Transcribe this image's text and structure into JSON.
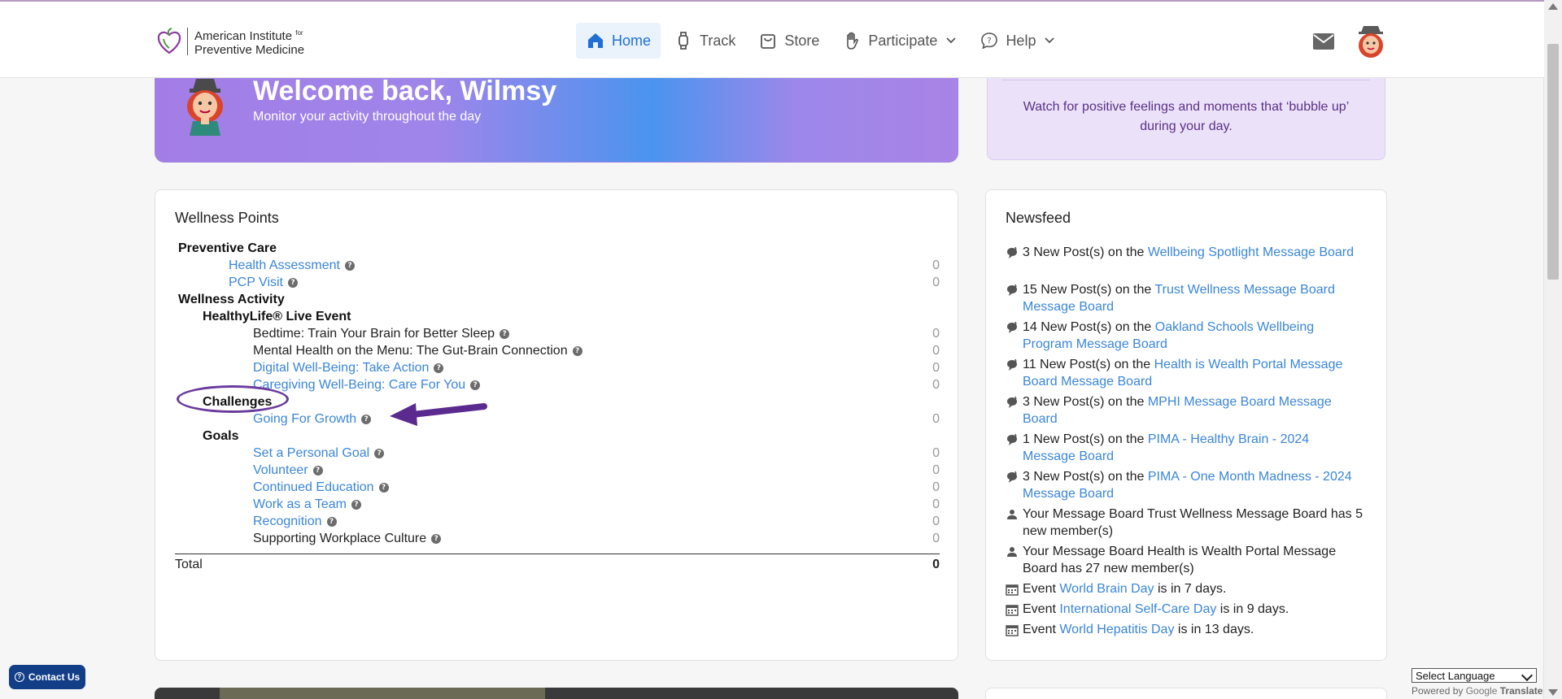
{
  "brand": {
    "line1": "American Institute",
    "line1_suffix": "for",
    "line2": "Preventive Medicine",
    "colors": {
      "accent": "#1f6fd6",
      "link": "#3a86d8",
      "purple": "#6a3b9c"
    }
  },
  "nav": {
    "home": "Home",
    "track": "Track",
    "store": "Store",
    "participate": "Participate",
    "help": "Help"
  },
  "banner": {
    "title": "Welcome back, Wilmsy",
    "subtitle": "Monitor your activity throughout the day"
  },
  "tip": {
    "text": "Watch for positive feelings and moments that ‘bubble up’ during your day."
  },
  "wellness": {
    "title": "Wellness Points",
    "rows": [
      {
        "label": "Preventive Care",
        "value": ""
      },
      {
        "label": "Health Assessment",
        "value": "0"
      },
      {
        "label": "PCP Visit",
        "value": "0"
      },
      {
        "label": "Wellness Activity",
        "value": ""
      },
      {
        "label": "HealthyLife® Live Event",
        "value": ""
      },
      {
        "label": "Bedtime: Train Your Brain for Better Sleep",
        "value": "0"
      },
      {
        "label": "Mental Health on the Menu: The Gut-Brain Connection",
        "value": "0"
      },
      {
        "label": "Digital Well-Being: Take Action",
        "value": "0"
      },
      {
        "label": "Caregiving Well-Being: Care For You",
        "value": "0"
      },
      {
        "label": "Challenges",
        "value": ""
      },
      {
        "label": "Going For Growth",
        "value": "0"
      },
      {
        "label": "Goals",
        "value": ""
      },
      {
        "label": "Set a Personal Goal",
        "value": "0"
      },
      {
        "label": "Volunteer",
        "value": "0"
      },
      {
        "label": "Continued Education",
        "value": "0"
      },
      {
        "label": "Work as a Team",
        "value": "0"
      },
      {
        "label": "Recognition",
        "value": "0"
      },
      {
        "label": "Supporting Workplace Culture",
        "value": "0"
      }
    ],
    "help_glyph": "?",
    "total_label": "Total",
    "total_value": "0"
  },
  "newsfeed": {
    "title": "Newsfeed",
    "items": [
      {
        "icon": "speech-bubble-icon",
        "pre": "3 New Post(s) on the ",
        "link": "Wellbeing Spotlight Message Board",
        "post": ""
      },
      {
        "icon": "speech-bubble-icon",
        "pre": "15 New Post(s) on the ",
        "link": "Trust Wellness Message Board Message Board",
        "post": ""
      },
      {
        "icon": "speech-bubble-icon",
        "pre": "14 New Post(s) on the ",
        "link": "Oakland Schools Wellbeing Program Message Board",
        "post": ""
      },
      {
        "icon": "speech-bubble-icon",
        "pre": "11 New Post(s) on the ",
        "link": "Health is Wealth Portal Message Board Message Board",
        "post": ""
      },
      {
        "icon": "speech-bubble-icon",
        "pre": "3 New Post(s) on the ",
        "link": "MPHI Message Board Message Board",
        "post": ""
      },
      {
        "icon": "speech-bubble-icon",
        "pre": "1 New Post(s) on the ",
        "link": "PIMA - Healthy Brain - 2024 Message Board",
        "post": ""
      },
      {
        "icon": "speech-bubble-icon",
        "pre": "3 New Post(s) on the ",
        "link": "PIMA - One Month Madness - 2024 Message Board",
        "post": ""
      },
      {
        "icon": "person-icon",
        "pre": "Your Message Board Trust Wellness Message Board has 5 new member(s)",
        "link": "",
        "post": ""
      },
      {
        "icon": "person-icon",
        "pre": "Your Message Board Health is Wealth Portal Message Board has 27 new member(s)",
        "link": "",
        "post": ""
      },
      {
        "icon": "calendar-icon",
        "pre": "Event ",
        "link": "World Brain Day",
        "post": " is in 7 days."
      },
      {
        "icon": "calendar-icon",
        "pre": "Event ",
        "link": "International Self-Care Day",
        "post": " is in 9 days."
      },
      {
        "icon": "calendar-icon",
        "pre": "Event ",
        "link": "World Hepatitis Day",
        "post": " is in 13 days."
      }
    ]
  },
  "footer": {
    "contact": "Contact Us",
    "language_select": "Select Language",
    "powered_by": "Powered by",
    "google": "Google",
    "translate": "Translate"
  }
}
